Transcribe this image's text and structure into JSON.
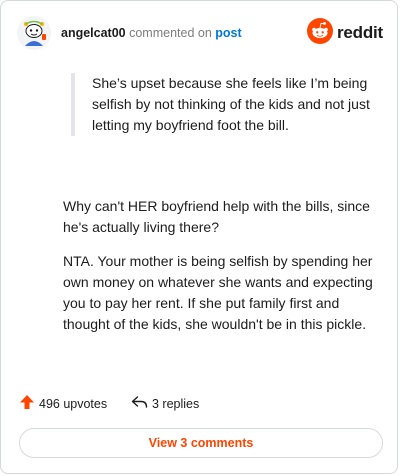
{
  "header": {
    "username": "angelcat00",
    "commented_on": "commented on",
    "post_link": "post",
    "brand": "reddit"
  },
  "comment": {
    "quote": "She’s upset because she feels like I’m being selfish by not thinking of the kids and not just letting my boyfriend foot the bill.",
    "paragraphs": [
      "Why can't HER boyfriend help with the bills, since he's actually living there?",
      "NTA. Your mother is being selfish by spending her own money on whatever she wants and expecting you to pay her rent. If she put family first and thought of the kids, she wouldn't be in this pickle."
    ]
  },
  "actions": {
    "upvotes_label": "496 upvotes",
    "replies_label": "3 replies"
  },
  "footer": {
    "view_label": "View 3 comments"
  },
  "colors": {
    "brand": "#ff4500",
    "link": "#0079d3"
  },
  "icons": [
    "avatar",
    "reddit-logo-icon",
    "upvote-arrow-icon",
    "reply-arrow-icon"
  ]
}
